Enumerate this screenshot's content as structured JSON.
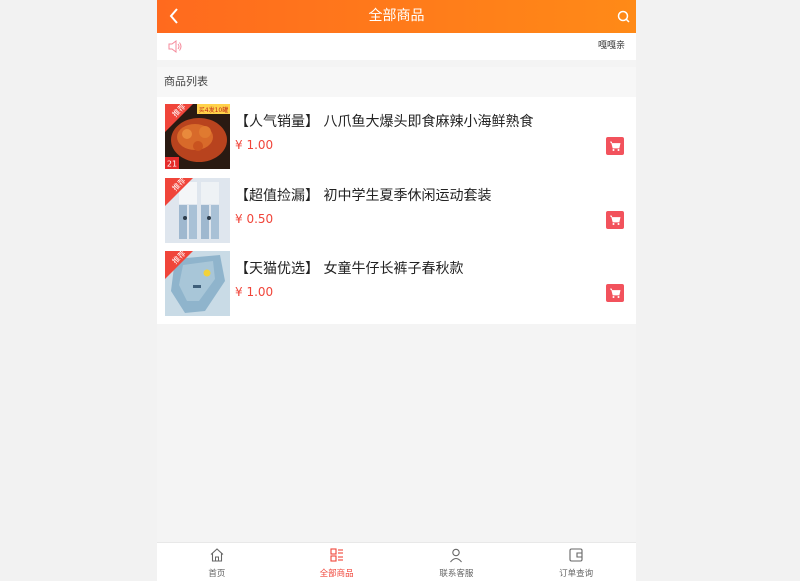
{
  "header": {
    "title": "全部商品"
  },
  "notice": {
    "text": "嘎嘎亲"
  },
  "section": {
    "title": "商品列表"
  },
  "products": [
    {
      "name": "【人气销量】 八爪鱼大爆头即食麻辣小海鲜熟食",
      "price": "¥ 1.00",
      "badge": "推荐",
      "image_text": "买4发10罐",
      "image_number": "21"
    },
    {
      "name": "【超值捡漏】 初中学生夏季休闲运动套装",
      "price": "¥ 0.50",
      "badge": "推荐"
    },
    {
      "name": "【天猫优选】 女童牛仔长裤子春秋款",
      "price": "¥ 1.00",
      "badge": "推荐"
    }
  ],
  "tabbar": {
    "items": [
      {
        "label": "首页",
        "icon": "home-icon"
      },
      {
        "label": "全部商品",
        "icon": "grid-list-icon",
        "active": true
      },
      {
        "label": "联系客服",
        "icon": "user-icon"
      },
      {
        "label": "订单查询",
        "icon": "wallet-icon"
      }
    ]
  },
  "colors": {
    "header_start": "#ff6a1e",
    "header_end": "#ff8a17",
    "price": "#f0453a",
    "cart": "#f2525c",
    "active_tab": "#f0453a"
  }
}
